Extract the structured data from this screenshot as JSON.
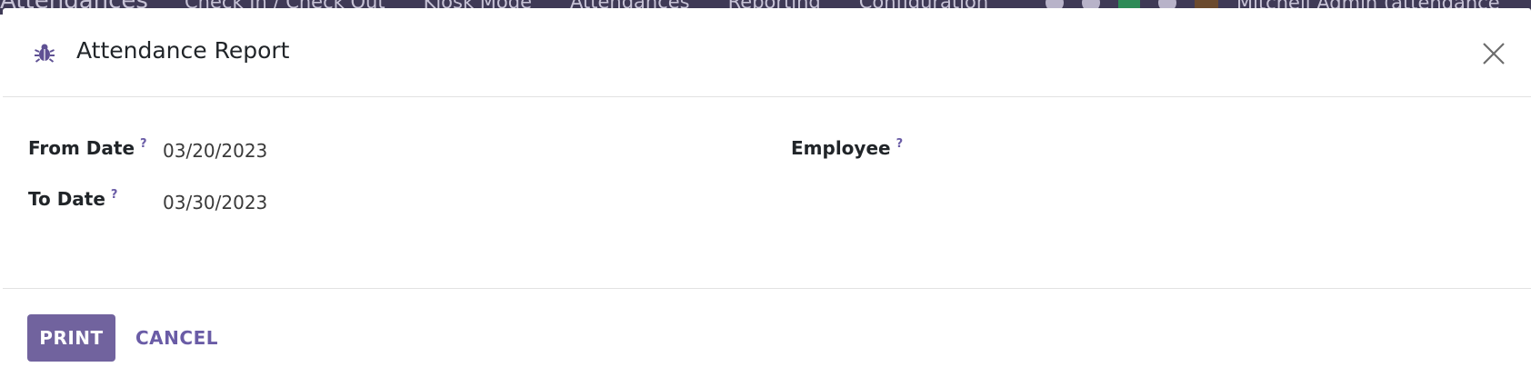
{
  "background_app": {
    "brand": "Attendances",
    "menu": [
      "Check In / Check Out",
      "Kiosk Mode",
      "Attendances",
      "Reporting",
      "Configuration"
    ],
    "user": "Mitchell Admin (attendance"
  },
  "dialog": {
    "icon": "bug-icon",
    "title": "Attendance Report",
    "fields": {
      "from_date": {
        "label": "From Date",
        "help": "?",
        "value": "03/20/2023"
      },
      "to_date": {
        "label": "To Date",
        "help": "?",
        "value": "03/30/2023"
      },
      "employee": {
        "label": "Employee",
        "help": "?",
        "value": ""
      }
    },
    "buttons": {
      "print": "PRINT",
      "cancel": "CANCEL"
    }
  },
  "colors": {
    "primary": "#71639e",
    "link": "#6a5ca6",
    "navbar": "#3f3a56"
  }
}
